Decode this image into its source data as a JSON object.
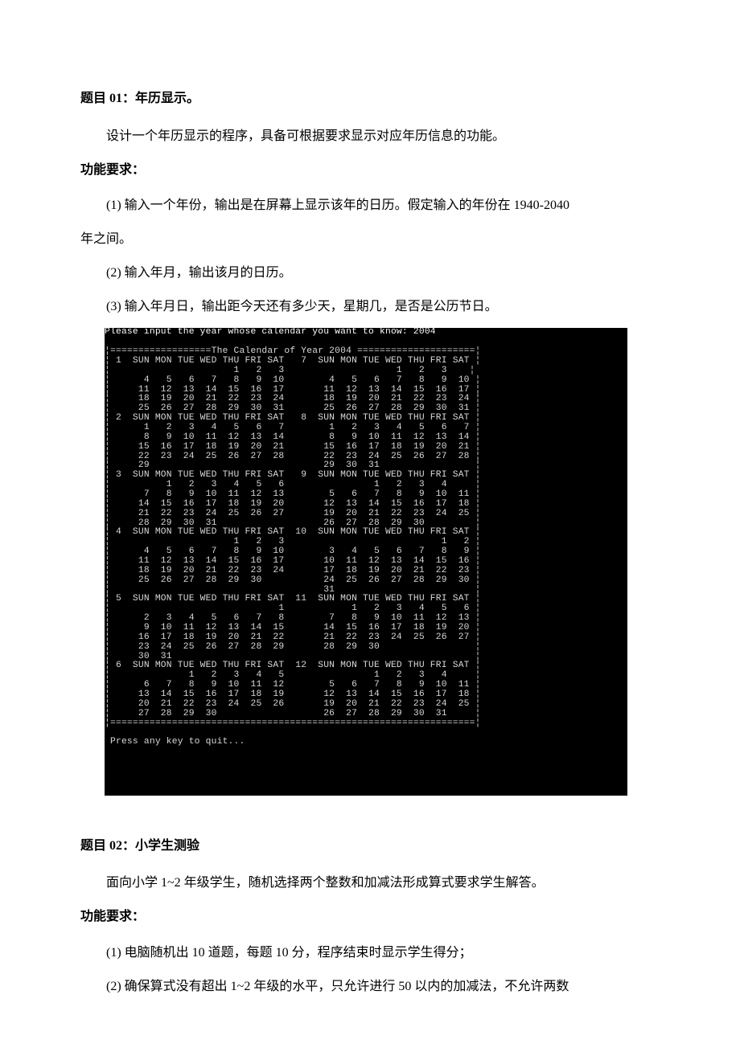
{
  "p1": {
    "heading": "题目 01：年历显示。",
    "intro": "设计一个年历显示的程序，具备可根据要求显示对应年历信息的功能。",
    "reqLabel": "功能要求：",
    "req1a": "(1) 输入一个年份，输出是在屏幕上显示该年的日历。假定输入的年份在 1940-2040",
    "req1b": "年之间。",
    "req2": "(2) 输入年月，输出该月的日历。",
    "req3": "(3) 输入年月日，输出距今天还有多少天，星期几，是否是公历节日。"
  },
  "terminal": {
    "line_input": "Please input the year whose calendar you want to know: 2004",
    "line_blank": " ",
    "line_rule_top": "¦==================The Calendar of Year 2004 =====================¦",
    "l01": "¦ 1  SUN MON TUE WED THU FRI SAT   7  SUN MON TUE WED THU FRI SAT ¦",
    "l02": "¦                      1   2   3                    1   2   3    ¦",
    "l03": "¦      4   5   6   7   8   9  10        4   5   6   7   8   9  10 ¦",
    "l04": "¦     11  12  13  14  15  16  17       11  12  13  14  15  16  17 ¦",
    "l05": "¦     18  19  20  21  22  23  24       18  19  20  21  22  23  24 ¦",
    "l06": "¦     25  26  27  28  29  30  31       25  26  27  28  29  30  31 ¦",
    "l07": "¦ 2  SUN MON TUE WED THU FRI SAT   8  SUN MON TUE WED THU FRI SAT ¦",
    "l08": "¦      1   2   3   4   5   6   7        1   2   3   4   5   6   7 ¦",
    "l09": "¦      8   9  10  11  12  13  14        8   9  10  11  12  13  14 ¦",
    "l10": "¦     15  16  17  18  19  20  21       15  16  17  18  19  20  21 ¦",
    "l11": "¦     22  23  24  25  26  27  28       22  23  24  25  26  27  28 ¦",
    "l12": "¦     29                               29  30  31                 ¦",
    "l13": "¦ 3  SUN MON TUE WED THU FRI SAT   9  SUN MON TUE WED THU FRI SAT ¦",
    "l14": "¦          1   2   3   4   5   6                1   2   3   4     ¦",
    "l15": "¦      7   8   9  10  11  12  13        5   6   7   8   9  10  11 ¦",
    "l16": "¦     14  15  16  17  18  19  20       12  13  14  15  16  17  18 ¦",
    "l17": "¦     21  22  23  24  25  26  27       19  20  21  22  23  24  25 ¦",
    "l18": "¦     28  29  30  31                   26  27  28  29  30         ¦",
    "l19": "¦ 4  SUN MON TUE WED THU FRI SAT  10  SUN MON TUE WED THU FRI SAT ¦",
    "l20": "¦                      1   2   3                            1   2 ¦",
    "l21": "¦      4   5   6   7   8   9  10        3   4   5   6   7   8   9 ¦",
    "l22": "¦     11  12  13  14  15  16  17       10  11  12  13  14  15  16 ¦",
    "l23": "¦     18  19  20  21  22  23  24       17  18  19  20  21  22  23 ¦",
    "l24": "¦     25  26  27  28  29  30           24  25  26  27  28  29  30 ¦",
    "l25": "¦                                      31                         ¦",
    "l26": "¦ 5  SUN MON TUE WED THU FRI SAT  11  SUN MON TUE WED THU FRI SAT ¦",
    "l27": "¦                              1            1   2   3   4   5   6 ¦",
    "l28": "¦      2   3   4   5   6   7   8        7   8   9  10  11  12  13 ¦",
    "l29": "¦      9  10  11  12  13  14  15       14  15  16  17  18  19  20 ¦",
    "l30": "¦     16  17  18  19  20  21  22       21  22  23  24  25  26  27 ¦",
    "l31": "¦     23  24  25  26  27  28  29       28  29  30                 ¦",
    "l32": "¦     30  31                                                      ¦",
    "l33": "¦ 6  SUN MON TUE WED THU FRI SAT  12  SUN MON TUE WED THU FRI SAT ¦",
    "l34": "¦              1   2   3   4   5                1   2   3   4     ¦",
    "l35": "¦      6   7   8   9  10  11  12        5   6   7   8   9  10  11 ¦",
    "l36": "¦     13  14  15  16  17  18  19       12  13  14  15  16  17  18 ¦",
    "l37": "¦     20  21  22  23  24  25  26       19  20  21  22  23  24  25 ¦",
    "l38": "¦     27  28  29  30                   26  27  28  29  30  31     ¦",
    "line_rule_bot": "¦=================================================================¦",
    "line_quit": " Press any key to quit..."
  },
  "p2": {
    "heading": "题目 02：小学生测验",
    "intro": "面向小学 1~2 年级学生，随机选择两个整数和加减法形成算式要求学生解答。",
    "reqLabel": "功能要求：",
    "req1": "(1) 电脑随机出 10 道题，每题 10 分，程序结束时显示学生得分；",
    "req2": "(2) 确保算式没有超出 1~2 年级的水平，只允许进行 50 以内的加减法，不允许两数"
  }
}
